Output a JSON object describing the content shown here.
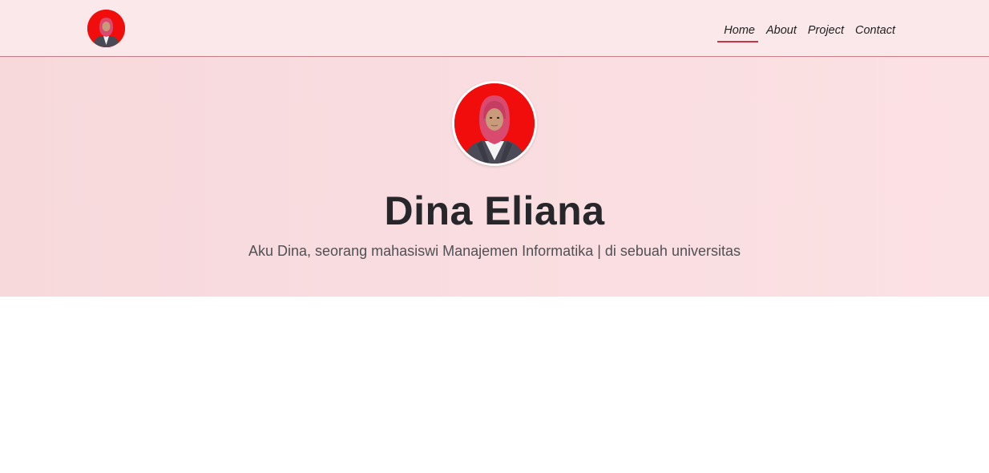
{
  "nav": {
    "brand_icon": "profile-photo",
    "links": [
      {
        "label": "Home",
        "active": true
      },
      {
        "label": "About",
        "active": false
      },
      {
        "label": "Project",
        "active": false
      },
      {
        "label": "Contact",
        "active": false
      }
    ]
  },
  "hero": {
    "avatar_icon": "profile-photo",
    "name": "Dina Eliana",
    "tagline": "Aku Dina, seorang mahasiswi Manajemen Informatika | di sebuah universitas"
  },
  "colors": {
    "nav_bg": "#fbe8ea",
    "hero_bg": "#f9dde0",
    "accent": "#c8324a",
    "photo_bg": "#f20d0d"
  }
}
